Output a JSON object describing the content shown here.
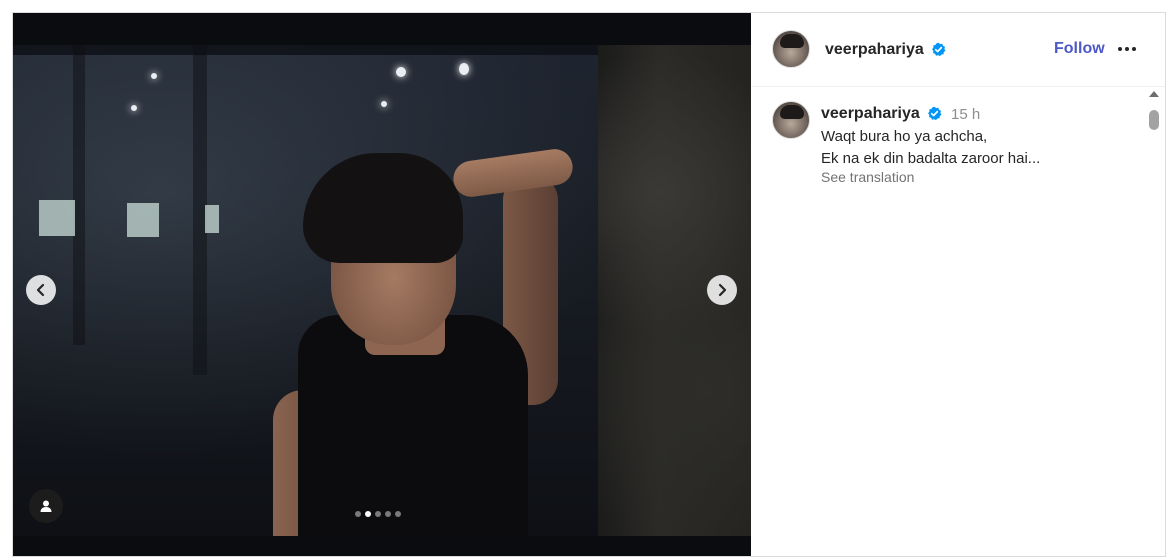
{
  "post": {
    "author": {
      "username": "veerpahariya",
      "verified": true
    },
    "header": {
      "follow_label": "Follow",
      "more_icon": "more-icon"
    },
    "caption": {
      "username": "veerpahariya",
      "time": "15 h",
      "lines": [
        "Waqt bura ho ya achcha,",
        "Ek na ek din badalta zaroor hai..."
      ],
      "see_translation": "See translation"
    },
    "carousel": {
      "total": 5,
      "current": 2
    },
    "colors": {
      "follow": "#4e59c8",
      "verified": "#0095f6",
      "text": "#262626",
      "muted": "#737373"
    },
    "icons": [
      "chevron-left-icon",
      "chevron-right-icon",
      "user-tag-icon",
      "verified-badge-icon"
    ]
  }
}
